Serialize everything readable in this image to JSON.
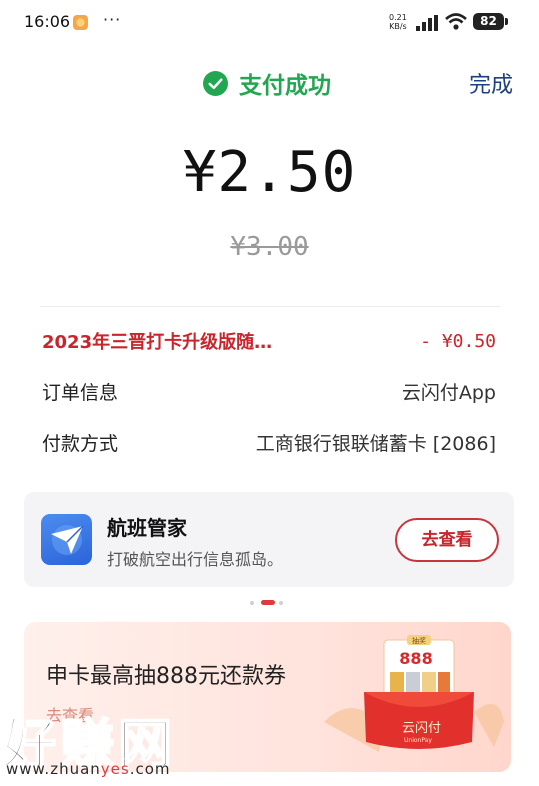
{
  "status_bar": {
    "time": "16:06",
    "more": "···",
    "net_speed_value": "0.21",
    "net_speed_unit": "KB/s",
    "battery": "82"
  },
  "header": {
    "success_title": "支付成功",
    "done_label": "完成"
  },
  "payment": {
    "amount": "¥2.50",
    "original_amount": "¥3.00"
  },
  "details": {
    "discount_label": "2023年三晋打卡升级版随…",
    "discount_value": "- ¥0.50",
    "order_label": "订单信息",
    "order_value": "云闪付App",
    "pay_method_label": "付款方式",
    "pay_method_value": "工商银行银联储蓄卡 [2086]"
  },
  "ad": {
    "title": "航班管家",
    "description": "打破航空出行信息孤岛。",
    "button_label": "去查看"
  },
  "banner": {
    "title": "申卡最高抽888元还款券",
    "subtitle": "去查看",
    "badge_top": "抽奖",
    "badge_amount": "888",
    "brand": "云闪付",
    "brand_sub": "UnionPay"
  },
  "watermark": {
    "logo": "好赚网",
    "url_pre": "www.zhuan",
    "url_hl": "yes",
    "url_post": ".com"
  },
  "colors": {
    "success_green": "#23a651",
    "discount_red": "#c8252d",
    "done_blue": "#1e3f80"
  }
}
